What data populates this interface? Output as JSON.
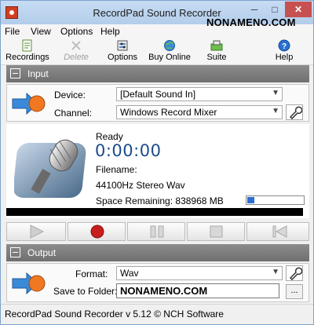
{
  "window": {
    "title": "RecordPad Sound Recorder",
    "brand_overlay": "NONAMENO.COM",
    "minimize": "─",
    "maximize": "□",
    "close": "✕"
  },
  "menu": [
    "File",
    "View",
    "Options",
    "Help"
  ],
  "toolbar": {
    "recordings": "Recordings",
    "delete": "Delete",
    "options": "Options",
    "buy_online": "Buy Online",
    "suite": "Suite",
    "help": "Help"
  },
  "input_section": {
    "title": "Input",
    "device_label": "Device:",
    "device_value": "[Default Sound In]",
    "channel_label": "Channel:",
    "channel_value": "Windows Record Mixer"
  },
  "status": {
    "state": "Ready",
    "time": "0:00:00",
    "filename_label": "Filename:",
    "format_info": "44100Hz Stereo Wav",
    "space_remaining": "Space Remaining: 838968 MB",
    "space_fraction": 0.12
  },
  "output_section": {
    "title": "Output",
    "format_label": "Format:",
    "format_value": "Wav",
    "folder_label": "Save to Folder:",
    "folder_value": "NONAMENO.COM",
    "browse": "..."
  },
  "statusbar": {
    "text": "RecordPad Sound Recorder v 5.12 © NCH Software"
  },
  "colors": {
    "accent": "#1c4b8c",
    "section_header": "#7d7d7d",
    "record": "#c81e1e",
    "progress": "#2a6fd1"
  },
  "icons": [
    "recordings-icon",
    "delete-icon",
    "options-icon",
    "buy-online-icon",
    "suite-icon",
    "help-icon",
    "play-icon",
    "record-icon",
    "pause-icon",
    "stop-icon",
    "skip-start-icon",
    "microphone-icon",
    "wrench-icon",
    "arrow-record-icon"
  ]
}
